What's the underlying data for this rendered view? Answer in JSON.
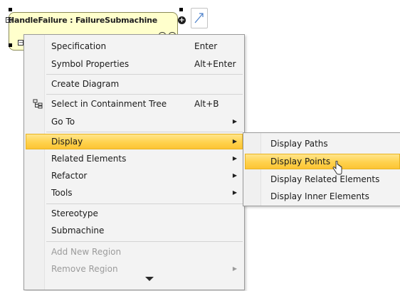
{
  "diagram": {
    "state_title": "HandleFailure : FailureSubmachine"
  },
  "context_menu": {
    "items": [
      {
        "label": "Specification",
        "accelerator": "Enter"
      },
      {
        "label": "Symbol Properties",
        "accelerator": "Alt+Enter"
      },
      {
        "label": "Create Diagram"
      },
      {
        "label": "Select in Containment Tree",
        "accelerator": "Alt+B",
        "icon": "containment-tree-icon"
      },
      {
        "label": "Go To"
      },
      {
        "label": "Display"
      },
      {
        "label": "Related Elements"
      },
      {
        "label": "Refactor"
      },
      {
        "label": "Tools"
      },
      {
        "label": "Stereotype"
      },
      {
        "label": "Submachine"
      },
      {
        "label": "Add New Region"
      },
      {
        "label": "Remove Region"
      }
    ],
    "highlighted_item": "Display",
    "disabled_items": [
      "Add New Region",
      "Remove Region"
    ]
  },
  "display_submenu": {
    "items": [
      {
        "label": "Display Paths"
      },
      {
        "label": "Display Points"
      },
      {
        "label": "Display Related Elements"
      },
      {
        "label": "Display Inner Elements"
      }
    ],
    "highlighted_item": "Display Points"
  },
  "colors": {
    "highlight": "#fcc434",
    "state_fill": "#ffffcc",
    "menu_bg": "#f3f3f3"
  },
  "icons": {
    "submenu_arrow": "triangle-right-icon",
    "scroll_down": "triangle-down-icon"
  }
}
